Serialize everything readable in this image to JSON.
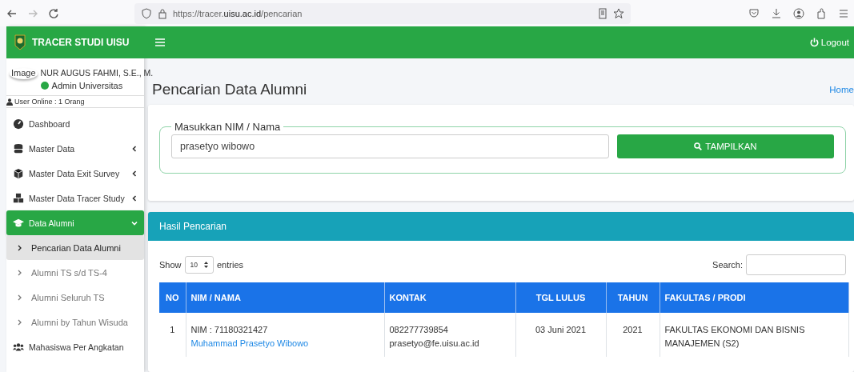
{
  "browser": {
    "url": "https://tracer.**uisu.ac.id**/pencarian"
  },
  "brand": {
    "title": "TRACER STUDI UISU"
  },
  "user": {
    "image_alt": "Image",
    "name": "NUR AUGUS FAHMI, S.E., M.",
    "role": "Admin Universitas",
    "online": "User Online : 1 Orang"
  },
  "sidebar": {
    "items": [
      {
        "label": "Dashboard",
        "selected": false
      },
      {
        "label": "Master Data",
        "selected": false,
        "expanded": false
      },
      {
        "label": "Master Data Exit Survey",
        "selected": false,
        "expanded": false
      },
      {
        "label": "Master Data Tracer Study",
        "selected": false,
        "expanded": false
      },
      {
        "label": "Data Alumni",
        "selected": true,
        "expanded": true,
        "children": [
          {
            "label": "Pencarian Data Alumni",
            "selected": true
          },
          {
            "label": "Alumni TS s/d TS-4",
            "selected": false
          },
          {
            "label": "Alumni Seluruh TS",
            "selected": false
          },
          {
            "label": "Alumni by Tahun Wisuda",
            "selected": false
          }
        ]
      },
      {
        "label": "Mahasiswa Per Angkatan",
        "selected": false
      }
    ]
  },
  "topbar": {
    "logout": "Logout"
  },
  "page": {
    "title": "Pencarian Data Alumni",
    "breadcrumb": "Home"
  },
  "search_form": {
    "legend": "Masukkan NIM / Nama",
    "value": "prasetyo wibowo",
    "button": "TAMPILKAN"
  },
  "results": {
    "title": "Hasil Pencarian",
    "show": "Show",
    "entries_value": "10",
    "entries": "entries",
    "search_label": "Search:",
    "table": {
      "columns": [
        "NO",
        "NIM / NAMA",
        "KONTAK",
        "TGL LULUS",
        "TAHUN",
        "FAKULTAS / PRODI"
      ],
      "rows": [
        {
          "no": "1",
          "nim": "NIM : 71180321427",
          "name": "Muhammad Prasetyo Wibowo",
          "phone": "082277739854",
          "email": "prasetyo@fe.uisu.ac.id",
          "graduated": "03 Juni 2021",
          "year": "2021",
          "faculty": "FAKULTAS EKONOMI DAN BISNIS",
          "program": "MANAJEMEN (S2)"
        }
      ]
    }
  }
}
